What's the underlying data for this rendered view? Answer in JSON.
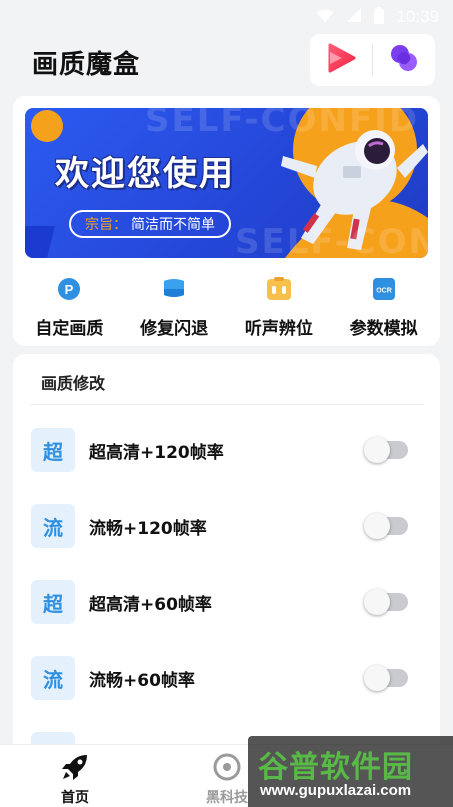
{
  "status_bar": {
    "time": "10:39",
    "icons": [
      "wifi-icon",
      "signal-icon",
      "battery-icon"
    ]
  },
  "header": {
    "title": "画质魔盒",
    "actions": [
      "play-store-icon",
      "link-icon"
    ]
  },
  "banner": {
    "title": "欢迎您使用",
    "subtitle_prefix": "宗旨：",
    "subtitle_text": "简洁而不简单",
    "background_text": "SELF-CONFID"
  },
  "quick_actions": [
    {
      "label": "自定画质",
      "icon": "custom-quality-icon"
    },
    {
      "label": "修复闪退",
      "icon": "repair-icon"
    },
    {
      "label": "听声辨位",
      "icon": "sound-locate-icon"
    },
    {
      "label": "参数模拟",
      "icon": "ocr-icon"
    }
  ],
  "settings": {
    "title": "画质修改",
    "items": [
      {
        "badge": "超",
        "label": "超高清+120帧率",
        "enabled": false
      },
      {
        "badge": "流",
        "label": "流畅+120帧率",
        "enabled": false
      },
      {
        "badge": "超",
        "label": "超高清+60帧率",
        "enabled": false
      },
      {
        "badge": "流",
        "label": "流畅+60帧率",
        "enabled": false
      }
    ]
  },
  "bottom_nav": {
    "items": [
      {
        "label": "首页",
        "icon": "rocket-icon",
        "active": true
      },
      {
        "label": "黑科技",
        "icon": "tech-icon",
        "active": false
      }
    ]
  },
  "watermark": {
    "main": "谷普软件园",
    "url": "www.gupuxlazai.com"
  },
  "colors": {
    "accent_blue": "#2f8fe0",
    "banner_blue": "#2547d9",
    "banner_orange": "#f6a11c",
    "watermark_green": "#58b947"
  }
}
